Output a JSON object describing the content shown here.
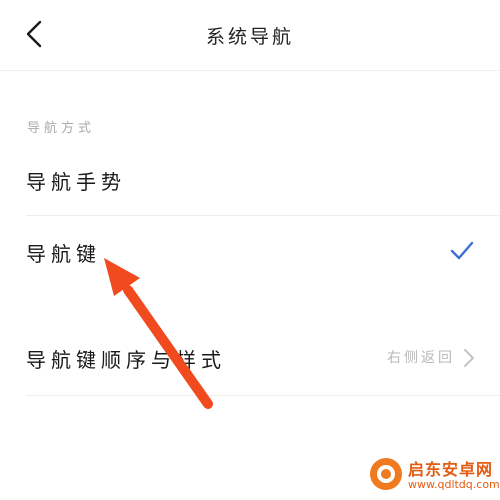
{
  "header": {
    "title": "系统导航"
  },
  "section": {
    "label": "导航方式"
  },
  "options": [
    {
      "label": "导航手势",
      "selected": false
    },
    {
      "label": "导航键",
      "selected": true
    }
  ],
  "settings_row": {
    "label": "导航键顺序与样式",
    "value": "右侧返回"
  },
  "colors": {
    "accent": "#3b6fd6",
    "annotation_arrow": "#f04a1e"
  },
  "icons": [
    "back-arrow-icon",
    "checkmark-icon",
    "chevron-right-icon"
  ],
  "watermark": {
    "title": "启东安卓网",
    "url": "www.qdltdq.com"
  }
}
